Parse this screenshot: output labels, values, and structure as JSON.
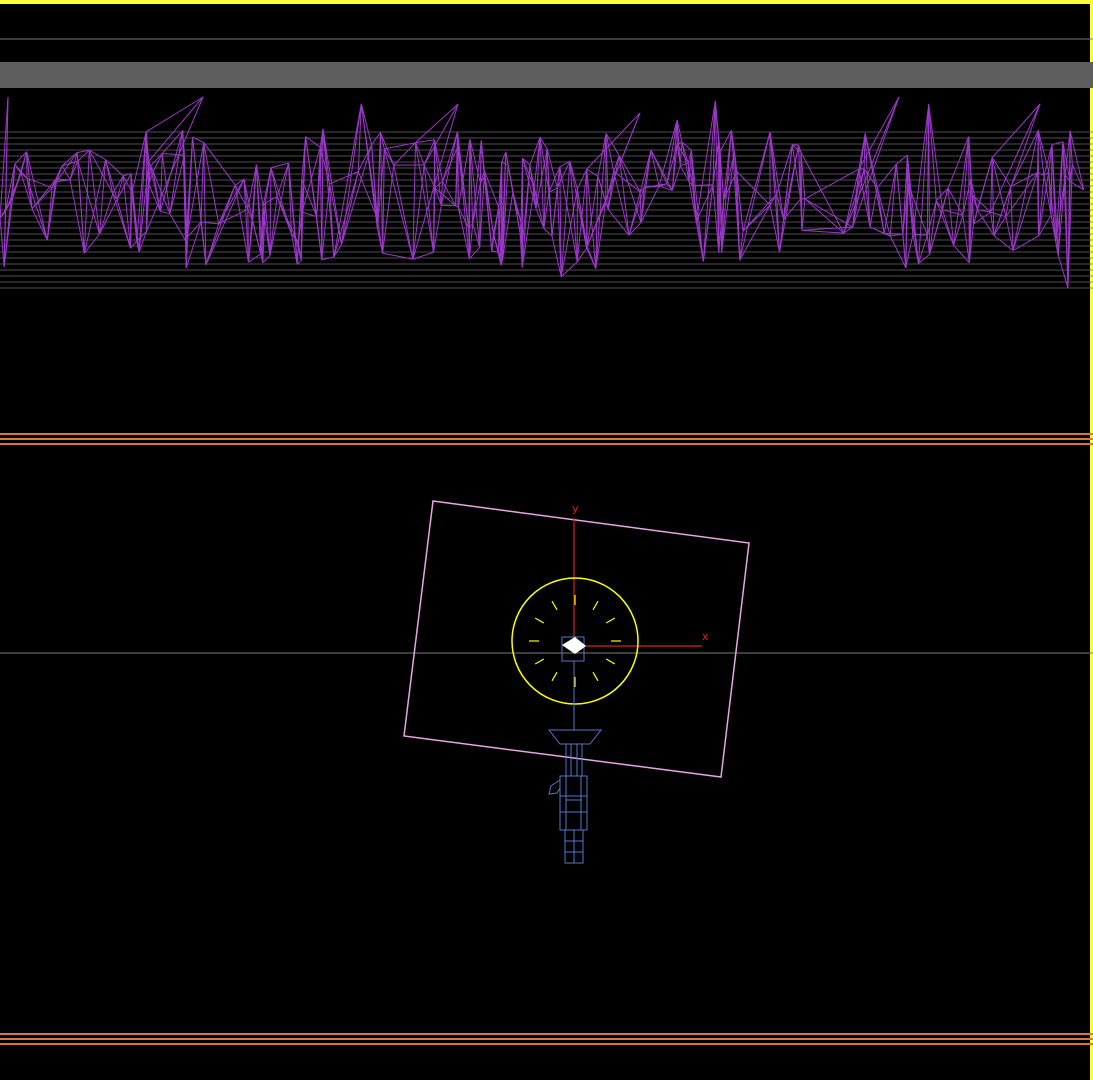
{
  "viewport": {
    "type": "wireframe-viewport",
    "colors": {
      "background": "#000000",
      "active_border": "#ffff33",
      "grid_line": "#7a7a7a",
      "band": "#5e5e5e",
      "terrain_wire": "#9b38c8",
      "terrain_hlines": "#6a6a6a",
      "ground_plane": "#d9743a",
      "camera_frame": "#e6a6e6",
      "axis": "#d92020",
      "light_gizmo": "#ffff00",
      "character_wire": "#5577cc",
      "center_marker": "#ffffff"
    }
  },
  "axes": {
    "x_label": "x",
    "y_label": "y"
  },
  "icons": {
    "light": "light-gizmo-icon",
    "camera": "camera-frame-icon",
    "character": "character-wireframe-icon",
    "terrain": "terrain-mesh-icon"
  }
}
